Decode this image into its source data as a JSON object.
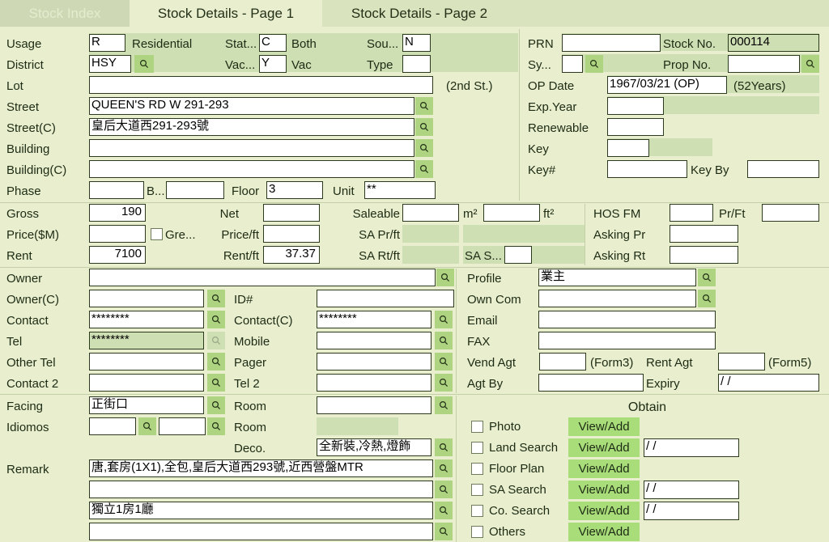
{
  "tabs": [
    {
      "label": "Stock Index",
      "state": "disabled"
    },
    {
      "label": "Stock Details - Page 1",
      "state": "active"
    },
    {
      "label": "Stock Details - Page 2",
      "state": "inactive"
    }
  ],
  "colors": {
    "page_bg": "#e8eece",
    "panel_tint": "#cfdfb4",
    "tab_inactive": "#d9e3bd",
    "tab_disabled": "#cfd8b4",
    "q_button": "#aed381",
    "view_add_button": "#a8dd7a",
    "field_border": "#2b3a1c"
  },
  "property": {
    "usage_label": "Usage",
    "usage_code": "R",
    "usage_text": "Residential",
    "status_label": "Stat...",
    "status_code": "C",
    "status_text": "Both",
    "source_label": "Sou...",
    "source_code": "N",
    "district_label": "District",
    "district_code": "HSY",
    "vacancy_label": "Vac...",
    "vacancy_code": "Y",
    "vacancy_text": "Vac",
    "type_label": "Type",
    "type_code": "",
    "lot_label": "Lot",
    "lot_value": "",
    "second_st_note": "(2nd St.)",
    "street_label": "Street",
    "street_value": "QUEEN'S RD W 291-293",
    "street_c_label": "Street(C)",
    "street_c_value": "皇后大道西291-293號",
    "building_label": "Building",
    "building_value": "",
    "building_c_label": "Building(C)",
    "building_c_value": "",
    "phase_label": "Phase",
    "phase_value": "",
    "block_label": "B...",
    "block_value": "",
    "floor_label": "Floor",
    "floor_value": "3",
    "unit_label": "Unit",
    "unit_value": "**"
  },
  "registry": {
    "prn_label": "PRN",
    "prn_value": "",
    "stock_no_label": "Stock No.",
    "stock_no_value": "000114",
    "sys_label": "Sy...",
    "sys_value": "",
    "prop_no_label": "Prop No.",
    "prop_no_value": "",
    "op_date_label": "OP Date",
    "op_date_value": "1967/03/21 (OP)",
    "age_note": "(52Years)",
    "exp_year_label": "Exp.Year",
    "exp_year_value": "",
    "renewable_label": "Renewable",
    "renewable_value": "",
    "key_label": "Key",
    "key_value": "",
    "key_no_label": "Key#",
    "key_no_value": "",
    "key_by_label": "Key By",
    "key_by_value": ""
  },
  "area_price": {
    "gross_label": "Gross",
    "gross_value": "190",
    "net_label": "Net",
    "net_value": "",
    "saleable_label": "Saleable",
    "saleable_value": "",
    "m2_label": "m²",
    "m2_value": "",
    "ft2_label": "ft²",
    "hos_fm_label": "HOS FM",
    "hos_fm_value": "",
    "pr_ft_label": "Pr/Ft",
    "pr_ft_value": "",
    "price_label": "Price($M)",
    "price_value": "",
    "green_label": "Gre...",
    "green_checked": false,
    "price_ft_label": "Price/ft",
    "price_ft_value": "",
    "sa_prft_label": "SA Pr/ft",
    "sa_prft_value": "",
    "sa_prft_note": "",
    "asking_pr_label": "Asking Pr",
    "asking_pr_value": "",
    "rent_label": "Rent",
    "rent_value": "7100",
    "rent_ft_label": "Rent/ft",
    "rent_ft_value": "37.37",
    "sa_rtft_label": "SA Rt/ft",
    "sa_rtft_value": "",
    "sa_s_label": "SA S...",
    "sa_s_value": "",
    "asking_rt_label": "Asking Rt",
    "asking_rt_value": ""
  },
  "contact": {
    "owner_label": "Owner",
    "owner_value": "",
    "owner_c_label": "Owner(C)",
    "owner_c_value": "",
    "id_label": "ID#",
    "id_value": "",
    "contact_label": "Contact",
    "contact_value": "********",
    "contact_c_label": "Contact(C)",
    "contact_c_value": "********",
    "tel_label": "Tel",
    "tel_value": "********",
    "mobile_label": "Mobile",
    "mobile_value": "",
    "other_tel_label": "Other Tel",
    "other_tel_value": "",
    "pager_label": "Pager",
    "pager_value": "",
    "contact2_label": "Contact 2",
    "contact2_value": "",
    "tel2_label": "Tel 2",
    "tel2_value": ""
  },
  "agency": {
    "profile_label": "Profile",
    "profile_value": "業主",
    "own_com_label": "Own Com",
    "own_com_value": "",
    "email_label": "Email",
    "email_value": "",
    "fax_label": "FAX",
    "fax_value": "",
    "vend_agt_label": "Vend Agt",
    "vend_agt_value": "",
    "form3_note": "(Form3)",
    "rent_agt_label": "Rent Agt",
    "rent_agt_value": "",
    "form5_note": "(Form5)",
    "agt_by_label": "Agt By",
    "agt_by_value": "",
    "expiry_label": "Expiry",
    "expiry_value": "/ /"
  },
  "details": {
    "facing_label": "Facing",
    "facing_value": "正街口",
    "room1_label": "Room",
    "room1_value": "",
    "idiomos_label": "Idiomos",
    "idiomos_value1": "",
    "idiomos_value2": "",
    "room2_label": "Room",
    "room2_value": "",
    "deco_label": "Deco.",
    "deco_value": "全新裝,冷熱,燈飾",
    "remark_label": "Remark",
    "remarks": [
      "唐,套房(1X1),全包,皇后大道西293號,近西營盤MTR",
      "",
      "獨立1房1廳",
      ""
    ]
  },
  "obtain": {
    "title": "Obtain",
    "button_label": "View/Add",
    "rows": [
      {
        "label": "Photo",
        "checked": false,
        "date": null
      },
      {
        "label": "Land Search",
        "checked": false,
        "date": "/ /"
      },
      {
        "label": "Floor Plan",
        "checked": false,
        "date": null
      },
      {
        "label": "SA Search",
        "checked": false,
        "date": "/ /"
      },
      {
        "label": "Co. Search",
        "checked": false,
        "date": "/ /"
      },
      {
        "label": "Others",
        "checked": false,
        "date": null
      }
    ]
  },
  "icons": {
    "search": "search-icon"
  }
}
